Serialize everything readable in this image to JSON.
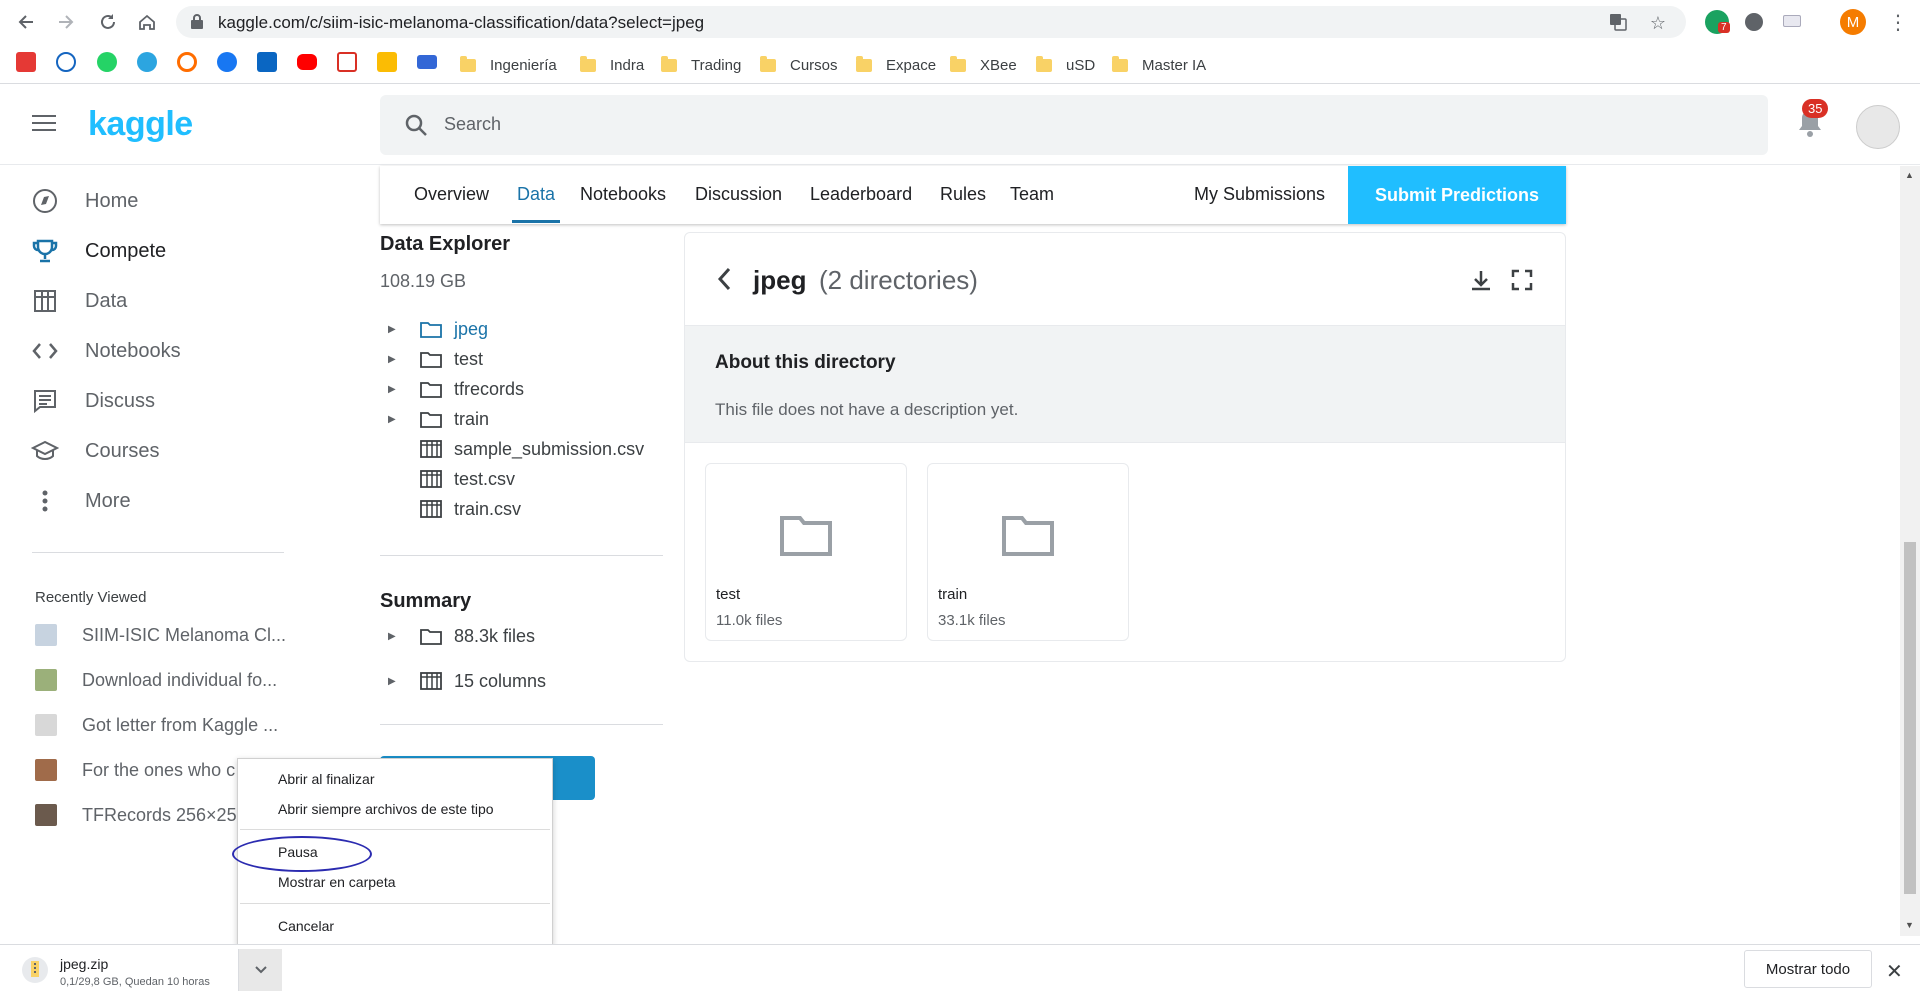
{
  "browser": {
    "url": "kaggle.com/c/siim-isic-melanoma-classification/data?select=jpeg",
    "profile_initial": "M",
    "extension_badge": "7"
  },
  "bookmarks": {
    "folders": [
      "Ingeniería",
      "Indra",
      "Trading",
      "Cursos",
      "Expace",
      "XBee",
      "uSD",
      "Master IA"
    ]
  },
  "header": {
    "logo": "kaggle",
    "search_placeholder": "Search",
    "notification_count": "35"
  },
  "sidebar": {
    "items": [
      {
        "label": "Home",
        "icon": "compass-icon"
      },
      {
        "label": "Compete",
        "icon": "trophy-icon"
      },
      {
        "label": "Data",
        "icon": "table-icon"
      },
      {
        "label": "Notebooks",
        "icon": "code-icon"
      },
      {
        "label": "Discuss",
        "icon": "comment-icon"
      },
      {
        "label": "Courses",
        "icon": "school-icon"
      },
      {
        "label": "More",
        "icon": "more-vert-icon"
      }
    ],
    "recently_viewed_title": "Recently Viewed",
    "recent": [
      "SIIM-ISIC Melanoma Cl...",
      "Download individual fo...",
      "Got letter from Kaggle ...",
      "For the ones who c",
      "TFRecords 256×25"
    ]
  },
  "tabs": {
    "items": [
      "Overview",
      "Data",
      "Notebooks",
      "Discussion",
      "Leaderboard",
      "Rules",
      "Team"
    ],
    "active": "Data",
    "my_submissions": "My Submissions",
    "submit": "Submit Predictions"
  },
  "explorer": {
    "title": "Data Explorer",
    "size": "108.19 GB",
    "tree": [
      {
        "name": "jpeg",
        "type": "folder"
      },
      {
        "name": "test",
        "type": "folder"
      },
      {
        "name": "tfrecords",
        "type": "folder"
      },
      {
        "name": "train",
        "type": "folder"
      },
      {
        "name": "sample_submission.csv",
        "type": "table"
      },
      {
        "name": "test.csv",
        "type": "table"
      },
      {
        "name": "train.csv",
        "type": "table"
      }
    ],
    "summary_title": "Summary",
    "summary": [
      {
        "label": "88.3k files",
        "type": "folder"
      },
      {
        "label": "15 columns",
        "type": "table"
      }
    ]
  },
  "directory": {
    "name": "jpeg",
    "count": "(2 directories)",
    "about_title": "About this directory",
    "about_desc": "This file does not have a description yet.",
    "cards": [
      {
        "name": "test",
        "files": "11.0k files"
      },
      {
        "name": "train",
        "files": "33.1k files"
      }
    ]
  },
  "context_menu": {
    "items": [
      "Abrir al finalizar",
      "Abrir siempre archivos de este tipo",
      "Pausa",
      "Mostrar en carpeta",
      "Cancelar"
    ]
  },
  "download": {
    "file": "jpeg.zip",
    "status": "0,1/29,8 GB, Quedan 10 horas",
    "show_all": "Mostrar todo"
  }
}
